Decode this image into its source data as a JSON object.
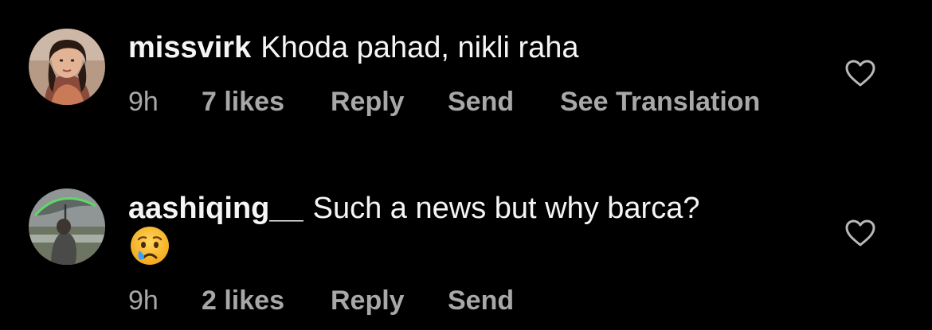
{
  "comments": [
    {
      "username": "missvirk",
      "text": "Khoda pahad, nikli raha",
      "time": "9h",
      "likes": "7 likes",
      "reply_label": "Reply",
      "send_label": "Send",
      "translate_label": "See Translation",
      "like_icon": "heart-outline-icon"
    },
    {
      "username": "aashiqing__",
      "text": "Such a news but why barca?",
      "emoji": "crying-face",
      "time": "9h",
      "likes": "2 likes",
      "reply_label": "Reply",
      "send_label": "Send",
      "like_icon": "heart-outline-icon"
    }
  ],
  "colors": {
    "background": "#000000",
    "primary_text": "#f5f5f5",
    "secondary_text": "#a8a8a8"
  }
}
